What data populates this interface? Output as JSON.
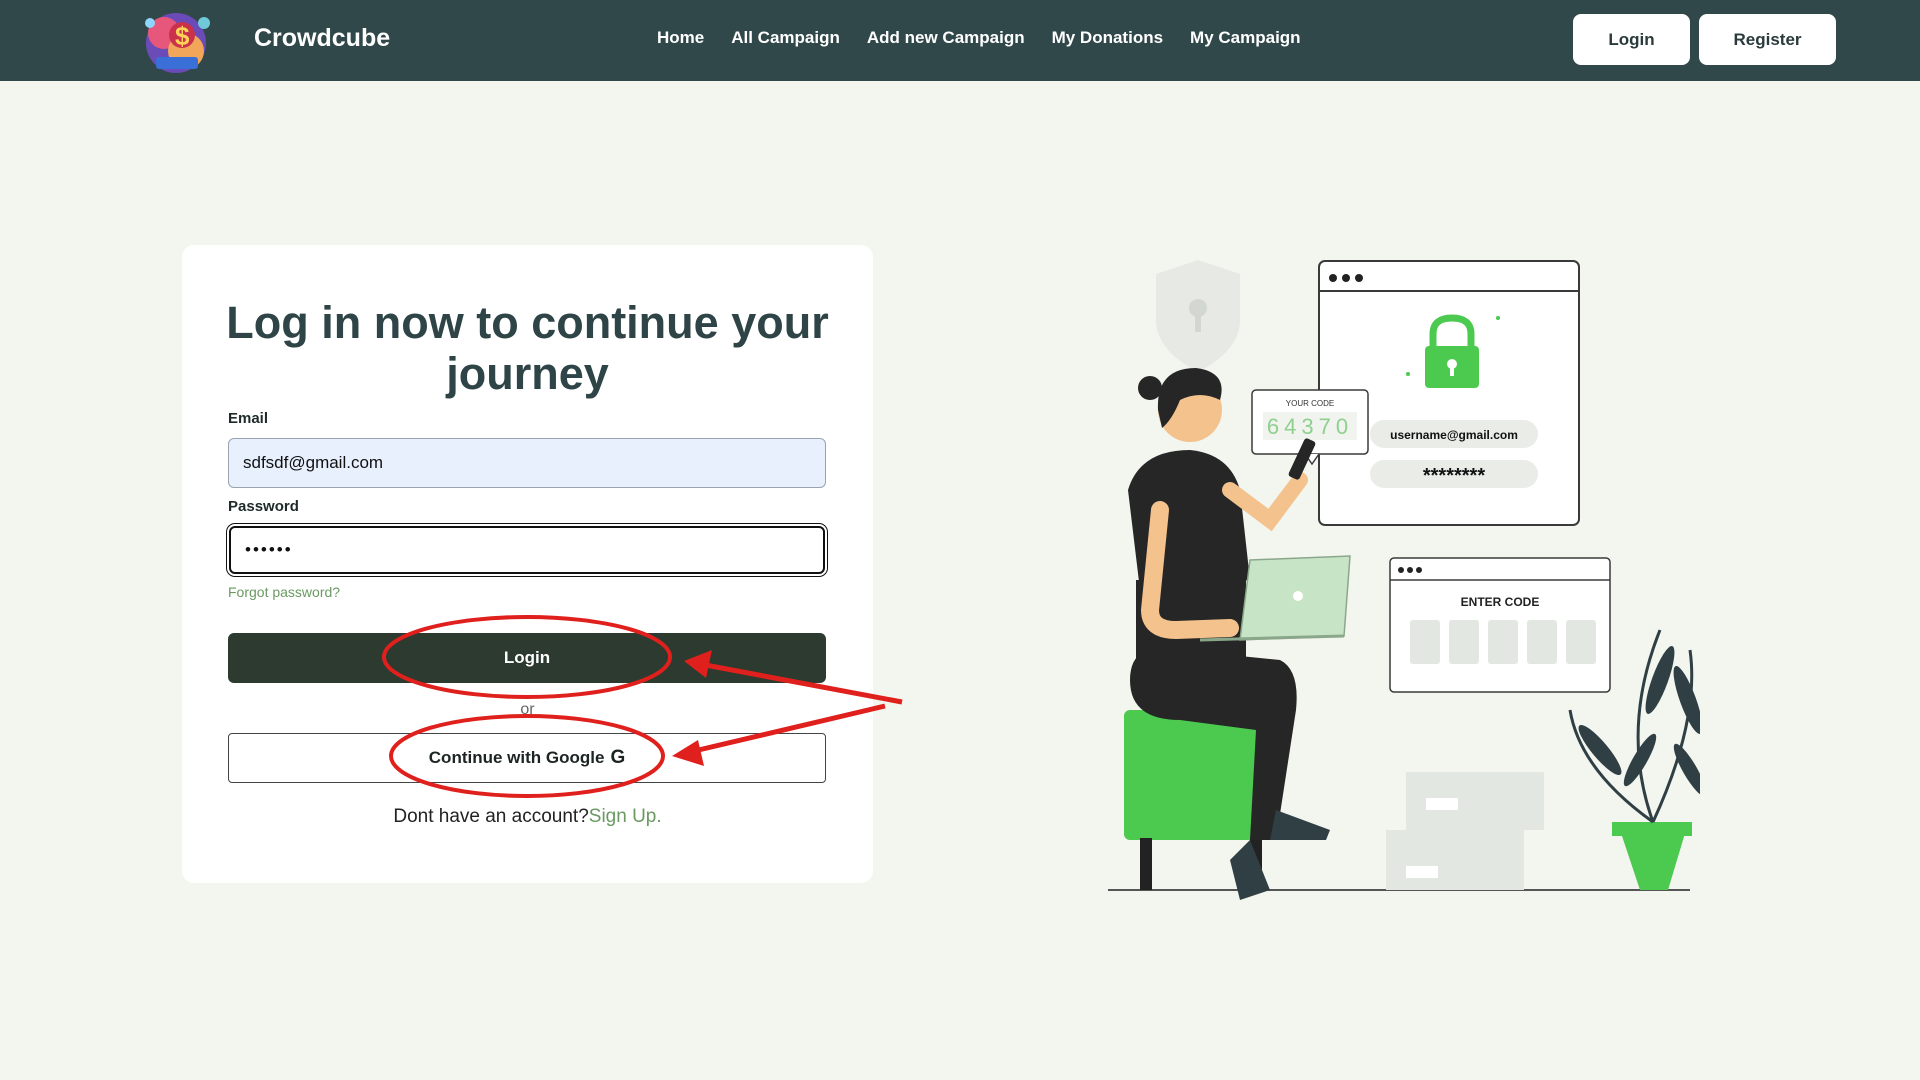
{
  "nav": {
    "brand": "Crowdcube",
    "links": [
      "Home",
      "All Campaign",
      "Add new Campaign",
      "My Donations",
      "My Campaign"
    ],
    "login_label": "Login",
    "register_label": "Register"
  },
  "form": {
    "title": "Log in now to continue your journey",
    "email_label": "Email",
    "email_value": "sdfsdf@gmail.com",
    "password_label": "Password",
    "password_value": "••••••",
    "forgot_label": "Forgot password?",
    "login_label": "Login",
    "or_label": "or",
    "google_label": "Continue with Google",
    "google_glyph": "G",
    "signup_prompt": "Dont have an account?",
    "signup_link": "Sign Up."
  },
  "illustration": {
    "your_code_label": "YOUR CODE",
    "code": "64370",
    "username": "username@gmail.com",
    "password_mask": "********",
    "enter_code_label": "ENTER CODE"
  },
  "colors": {
    "navbar": "#31484a",
    "background": "#f3f5ef",
    "primary_button": "#2c3a2f",
    "link_green": "#6a9a62",
    "illustration_green": "#4cc94f",
    "annotation_red": "#e0201c"
  },
  "icons": {
    "logo": "crowdfunding-money-bag-logo",
    "google": "google-g-icon"
  }
}
